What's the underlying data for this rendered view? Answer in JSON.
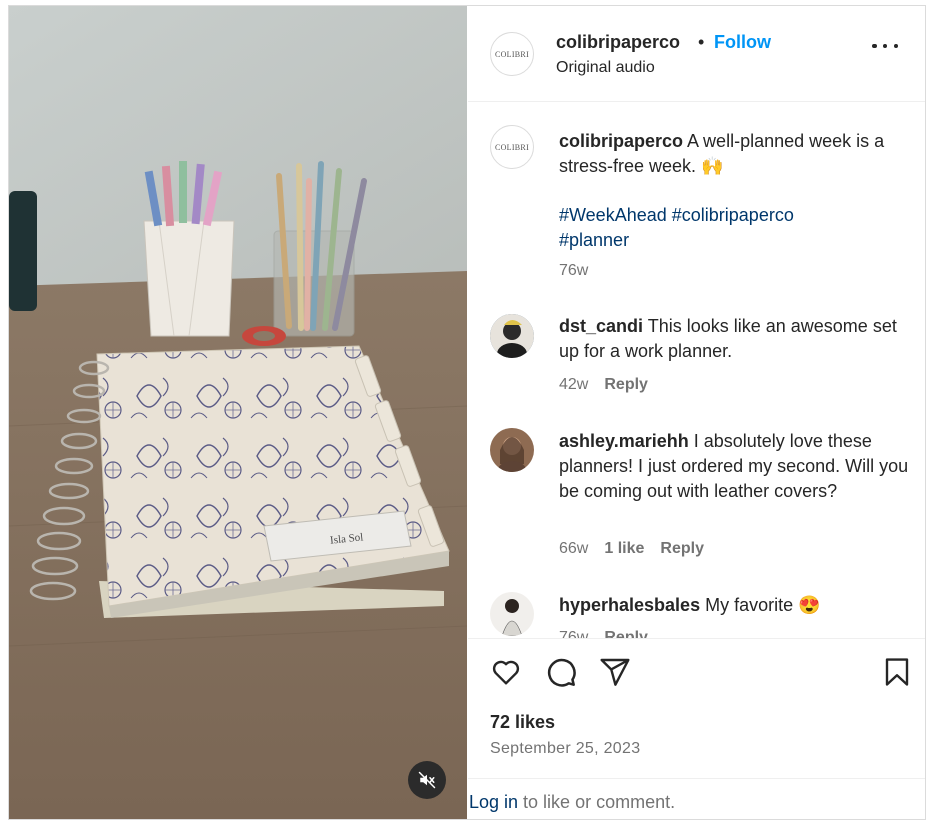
{
  "header": {
    "username": "colibripaperco",
    "separator": "•",
    "follow_label": "Follow",
    "audio": "Original audio",
    "avatar_logo_text": "COLIBRI"
  },
  "caption": {
    "username": "colibripaperco",
    "text": "A well-planned week is a stress-free week. 🙌",
    "hashtags": [
      "#WeekAhead",
      "#colibripaperco",
      "#planner"
    ],
    "time": "76w"
  },
  "comments": [
    {
      "username": "dst_candi",
      "text": "This looks like an awesome set up for a work planner.",
      "time": "42w",
      "likes": "",
      "reply": "Reply"
    },
    {
      "username": "ashley.mariehh",
      "text": "I absolutely love these planners! I just ordered my second. Will you be coming out with leather covers?",
      "time": "66w",
      "likes": "1 like",
      "reply": "Reply"
    },
    {
      "username": "hyperhalesbales",
      "text": "My favorite 😍",
      "time": "76w",
      "likes": "",
      "reply": "Reply"
    }
  ],
  "footer": {
    "likes": "72 likes",
    "date": "September 25, 2023",
    "login_link": "Log in",
    "login_rest": " to like or comment."
  },
  "media": {
    "nameplate_text": "Isla Sol",
    "muted": true
  },
  "icons": [
    "heart-icon",
    "comment-icon",
    "share-icon",
    "bookmark-icon",
    "more-icon",
    "mute-icon"
  ]
}
